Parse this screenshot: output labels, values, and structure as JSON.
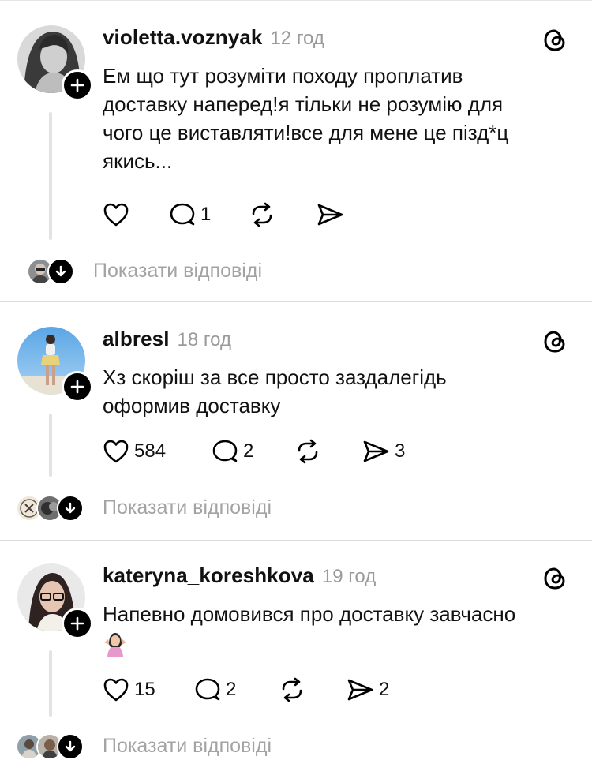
{
  "posts": [
    {
      "username": "violetta.voznyak",
      "time": "12 год",
      "text_lines": [
        "Ем що тут розуміти походу проплатив",
        "доставку наперед!я тільки не розумію для",
        "чого це виставляти!все для мене це пізд*ц",
        "якись..."
      ],
      "likes": "",
      "comments": "1",
      "reposts": "",
      "shares": "",
      "show_replies": "Показати відповіді"
    },
    {
      "username": "albresl",
      "time": "18 год",
      "text_lines": [
        "Хз скоріш за все просто заздалегідь",
        "оформив доставку"
      ],
      "likes": "584",
      "comments": "2",
      "reposts": "",
      "shares": "3",
      "show_replies": "Показати відповіді"
    },
    {
      "username": "kateryna_koreshkova",
      "time": "19 год",
      "text_lines": [
        "Напевно домовився про доставку завчасно"
      ],
      "emoji": "person-shrugging-emoji",
      "likes": "15",
      "comments": "2",
      "reposts": "",
      "shares": "2",
      "show_replies": "Показати відповіді"
    }
  ],
  "icons": {
    "like": "heart-icon",
    "comment": "comment-icon",
    "repost": "repost-icon",
    "share": "share-icon",
    "threads": "threads-logo-icon",
    "follow": "plus-icon",
    "expand": "arrow-down-icon"
  },
  "colors": {
    "muted_text": "#9a9a9a",
    "separator": "#dcdcdc",
    "thread_line": "#e3e3e3"
  }
}
